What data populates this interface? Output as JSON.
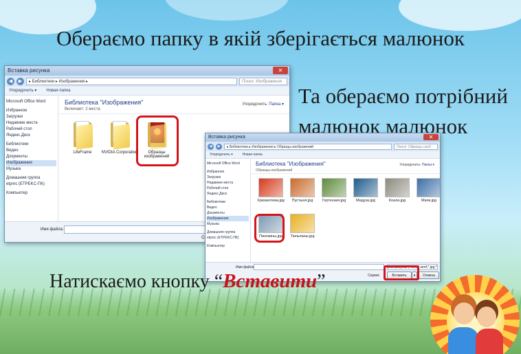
{
  "slide": {
    "heading1": "Обераємо папку в якій зберігається малюнок",
    "heading2_line1": "Та обераємо потрібний",
    "heading2_line2": "малюнок малюнок",
    "heading3_prefix": "Натискаємо кнопку “",
    "heading3_highlight": "Вставити",
    "heading3_suffix": "”"
  },
  "dialog1": {
    "title": "Вставка рисунка",
    "path": "▸ Библиотеки ▸ Изображения ▸",
    "search_placeholder": "Поиск: Изображения",
    "toolbar": [
      "Упорядочить ▾",
      "Новая папка"
    ],
    "sidebar": [
      "Microsoft Office Word",
      "Избранное",
      "Загрузки",
      "Недавние места",
      "Рабочий стол",
      "Яндекс.Диск",
      "Библиотеки",
      "Видео",
      "Документы",
      "Изображения",
      "Музыка",
      "Домашняя группа",
      "etpmc (ETPEKC-ПК)",
      "Компьютер"
    ],
    "library_title": "Библиотека \"Изображения\"",
    "library_sub": "Включает: 2 места",
    "arrange_label": "Упорядочить:",
    "arrange_value": "Папка ▾",
    "folders": [
      {
        "name": "LifeFrame"
      },
      {
        "name": "NVIDIA Corporation"
      },
      {
        "name": "Образцы изображений"
      }
    ],
    "filename_label": "Имя файла:",
    "service_label": "Се"
  },
  "dialog2": {
    "title": "Вставка рисунка",
    "path": "▸ Библиотеки ▸ Изображения ▸ Образцы изображений",
    "search_placeholder": "Поиск: Образцы изоб",
    "toolbar": [
      "Упорядочить ▾",
      "Новая папка"
    ],
    "sidebar": [
      "Microsoft Office Word",
      "Избранное",
      "Загрузки",
      "Недавние места",
      "Рабочий стол",
      "Яндекс.Диск",
      "Библиотеки",
      "Видео",
      "Документы",
      "Изображения",
      "Музыка",
      "Домашняя группа",
      "etpmc (ETPEKC-ПК)",
      "Компьютер"
    ],
    "library_title": "Библиотека \"Изображения\"",
    "library_sub": "Образцы изображений",
    "arrange_label": "Упорядочить:",
    "arrange_value": "Папка ▾",
    "thumbnails": [
      {
        "name": "Хризантема.jpg",
        "color": "#d63a1c"
      },
      {
        "name": "Пустыня.jpg",
        "color": "#c96a2b"
      },
      {
        "name": "Гортензия.jpg",
        "color": "#5f8a3a"
      },
      {
        "name": "Медуза.jpg",
        "color": "#1f5b8c"
      },
      {
        "name": "Коала.jpg",
        "color": "#8d8a7e"
      },
      {
        "name": "Маяк.jpg",
        "color": "#3c6fa6"
      },
      {
        "name": "Пингвины.jpg",
        "color": "#7d99b3"
      },
      {
        "name": "Тюльпаны.jpg",
        "color": "#e8b022"
      }
    ],
    "filename_label": "Имя файла:",
    "filetype_value": "Все рисунки (*.emf;*.wmf;*.jpg;*.jp",
    "service_label": "Сервис",
    "insert_button": "Вставить",
    "cancel_button": "Отмена"
  },
  "colors": {
    "highlight_red": "#d4141c",
    "title_text": "#1b1b1b"
  }
}
